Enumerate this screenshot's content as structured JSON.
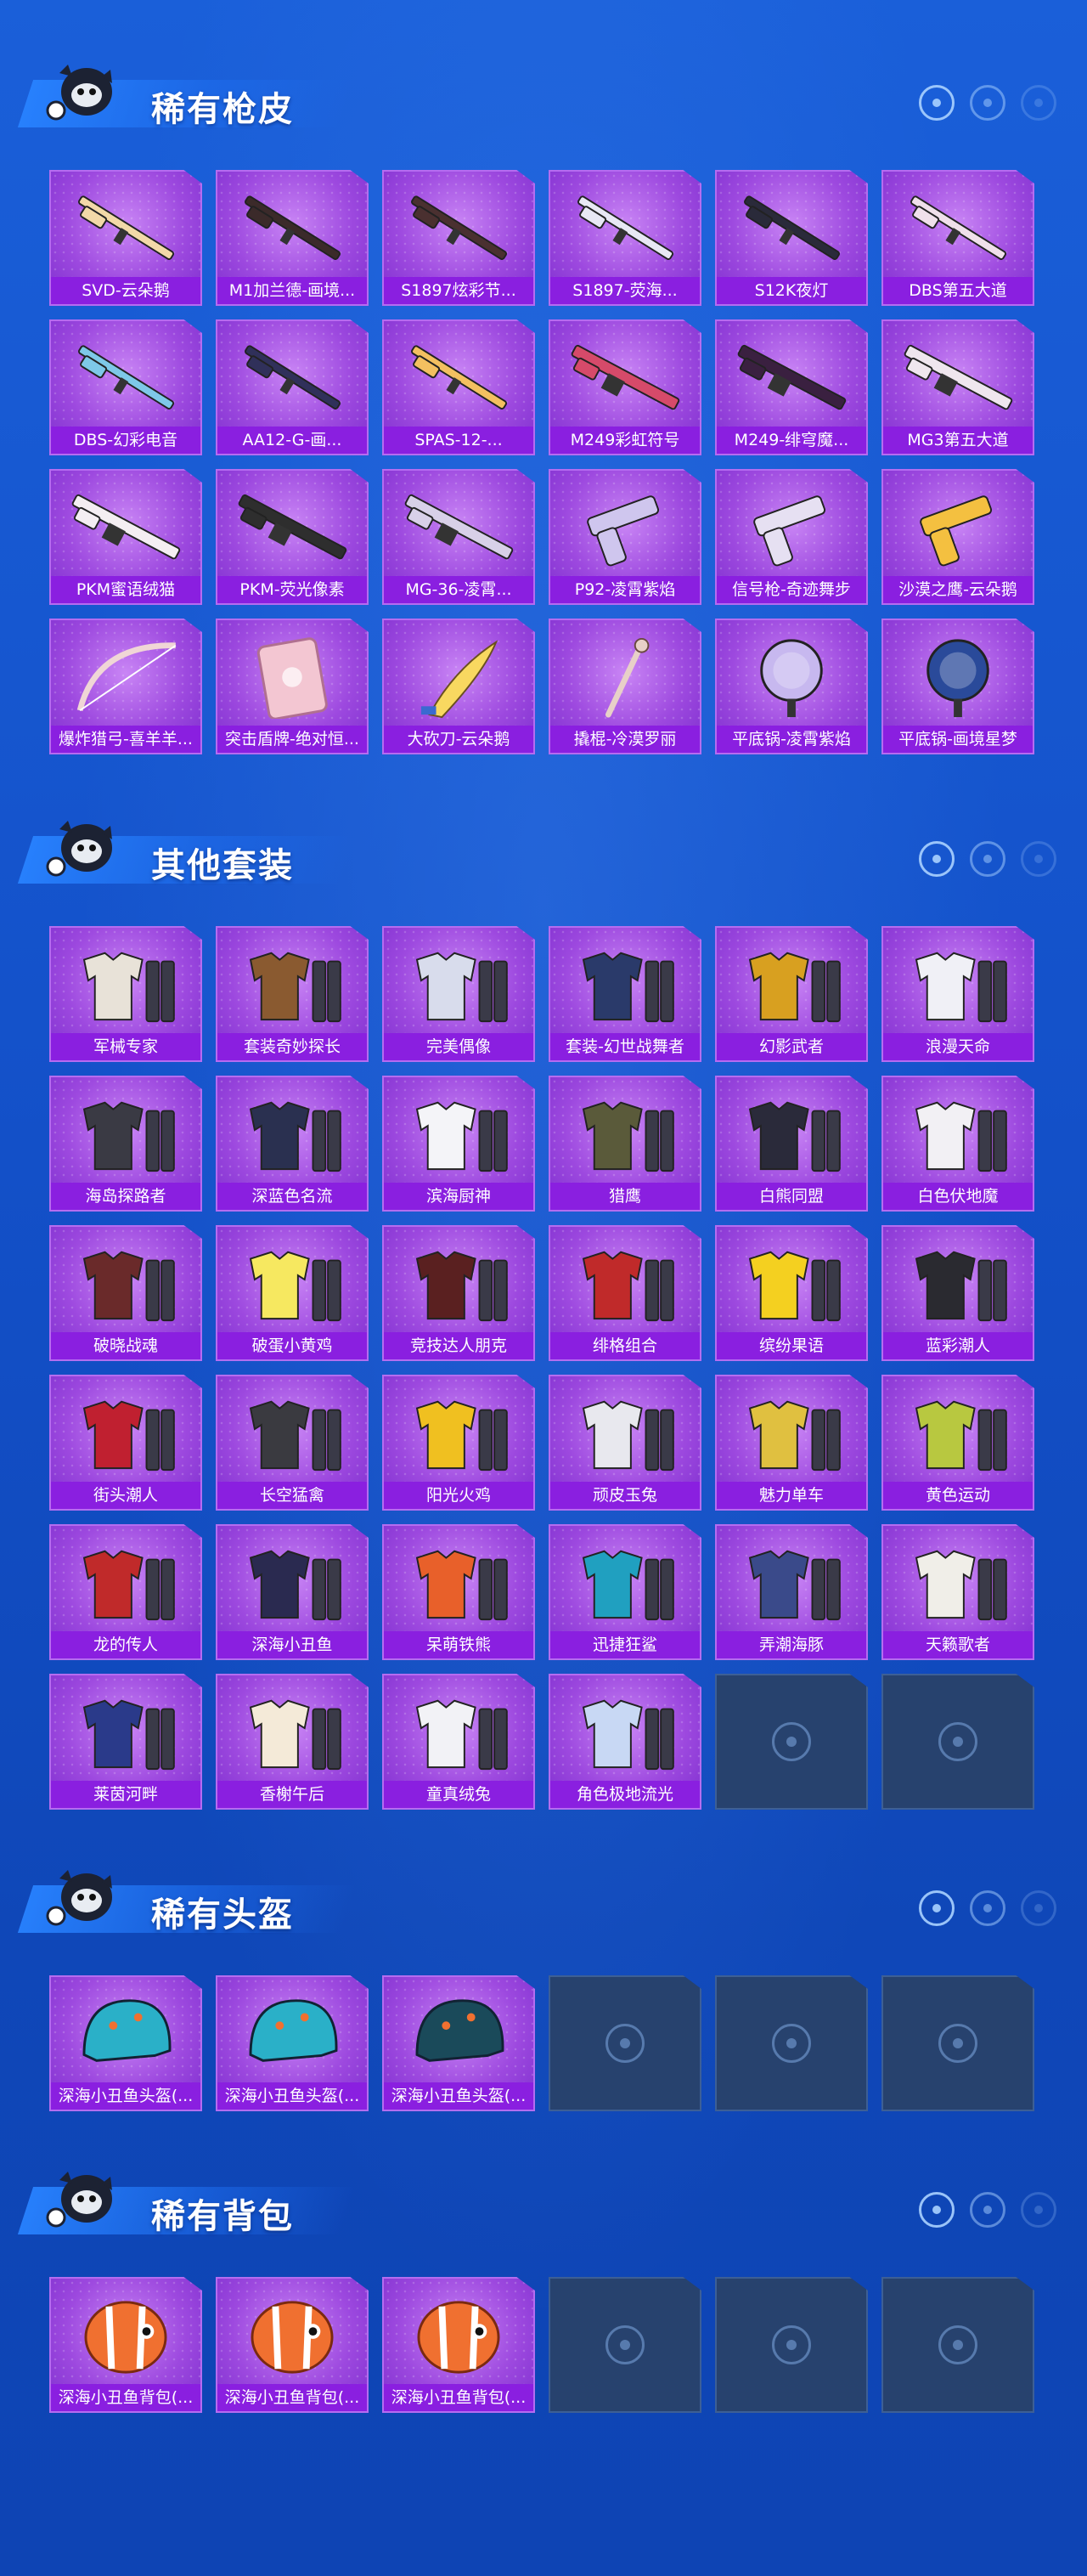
{
  "sections": [
    {
      "title": "稀有枪皮",
      "items": [
        {
          "label": "SVD-云朵鹅",
          "icon": "rifle-icon",
          "color": "#f2d9a8"
        },
        {
          "label": "M1加兰德-画境...",
          "icon": "rifle-icon",
          "color": "#3b2a2a"
        },
        {
          "label": "S1897炫彩节...",
          "icon": "shotgun-icon",
          "color": "#4a3030"
        },
        {
          "label": "S1897-荧海...",
          "icon": "shotgun-icon",
          "color": "#e8e8f4"
        },
        {
          "label": "S12K夜灯",
          "icon": "shotgun-icon",
          "color": "#2a2a3a"
        },
        {
          "label": "DBS第五大道",
          "icon": "shotgun-icon",
          "color": "#f0e0ea"
        },
        {
          "label": "DBS-幻彩电音",
          "icon": "shotgun-icon",
          "color": "#7ec8e8"
        },
        {
          "label": "AA12-G-画...",
          "icon": "shotgun-icon",
          "color": "#30305a"
        },
        {
          "label": "SPAS-12-...",
          "icon": "shotgun-icon",
          "color": "#f3c060"
        },
        {
          "label": "M249彩虹符号",
          "icon": "machinegun-icon",
          "color": "#d64a6a"
        },
        {
          "label": "M249-绯穹魔...",
          "icon": "machinegun-icon",
          "color": "#3a2040"
        },
        {
          "label": "MG3第五大道",
          "icon": "machinegun-icon",
          "color": "#efe6ee"
        },
        {
          "label": "PKM蜜语绒猫",
          "icon": "machinegun-icon",
          "color": "#f4eef2"
        },
        {
          "label": "PKM-荧光像素",
          "icon": "machinegun-icon",
          "color": "#2e2e2e"
        },
        {
          "label": "MG-36-凌霄...",
          "icon": "machinegun-icon",
          "color": "#d8d0e8"
        },
        {
          "label": "P92-凌霄紫焰",
          "icon": "pistol-icon",
          "color": "#cfc6ee"
        },
        {
          "label": "信号枪-奇迹舞步",
          "icon": "flaregun-icon",
          "color": "#e6e0f2"
        },
        {
          "label": "沙漠之鹰-云朵鹅",
          "icon": "pistol-icon",
          "color": "#f4c040"
        },
        {
          "label": "爆炸猎弓-喜羊羊...",
          "icon": "bow-icon",
          "color": "#f0d6d6"
        },
        {
          "label": "突击盾牌-绝对恒...",
          "icon": "shield-icon",
          "color": "#f3c6d2"
        },
        {
          "label": "大砍刀-云朵鹅",
          "icon": "machete-icon",
          "color": "#f8d860"
        },
        {
          "label": "撬棍-冷漠罗丽",
          "icon": "crowbar-icon",
          "color": "#e8d0c8"
        },
        {
          "label": "平底锅-凌霄紫焰",
          "icon": "pan-icon",
          "color": "#c7b8ef"
        },
        {
          "label": "平底锅-画境星梦",
          "icon": "pan-icon",
          "color": "#2a4a9a"
        }
      ]
    },
    {
      "title": "其他套装",
      "items": [
        {
          "label": "军械专家",
          "icon": "outfit-icon",
          "color": "#e8e2d8"
        },
        {
          "label": "套装奇妙探长",
          "icon": "outfit-icon",
          "color": "#8a5a30"
        },
        {
          "label": "完美偶像",
          "icon": "outfit-icon",
          "color": "#d8dcec"
        },
        {
          "label": "套装-幻世战舞者",
          "icon": "outfit-icon",
          "color": "#2a3a6a"
        },
        {
          "label": "幻影武者",
          "icon": "outfit-icon",
          "color": "#d8a020"
        },
        {
          "label": "浪漫天命",
          "icon": "outfit-icon",
          "color": "#f0f0f6"
        },
        {
          "label": "海岛探路者",
          "icon": "outfit-icon",
          "color": "#3a3a44"
        },
        {
          "label": "深蓝色名流",
          "icon": "outfit-icon",
          "color": "#2a3050"
        },
        {
          "label": "滨海厨神",
          "icon": "outfit-icon",
          "color": "#f4f4f8"
        },
        {
          "label": "猎鹰",
          "icon": "outfit-icon",
          "color": "#5a5a3a"
        },
        {
          "label": "白熊同盟",
          "icon": "outfit-icon",
          "color": "#2a2a3a"
        },
        {
          "label": "白色伏地魔",
          "icon": "outfit-icon",
          "color": "#f2f0f4"
        },
        {
          "label": "破晓战魂",
          "icon": "outfit-icon",
          "color": "#6a2a2a"
        },
        {
          "label": "破蛋小黄鸡",
          "icon": "outfit-icon",
          "color": "#f6e860"
        },
        {
          "label": "竞技达人朋克",
          "icon": "outfit-icon",
          "color": "#5a2020"
        },
        {
          "label": "绯格组合",
          "icon": "outfit-icon",
          "color": "#c02a2a"
        },
        {
          "label": "缤纷果语",
          "icon": "outfit-icon",
          "color": "#f4d020"
        },
        {
          "label": "蓝彩潮人",
          "icon": "outfit-icon",
          "color": "#2a2a30"
        },
        {
          "label": "街头潮人",
          "icon": "outfit-icon",
          "color": "#c02030"
        },
        {
          "label": "长空猛禽",
          "icon": "outfit-icon",
          "color": "#3a3a40"
        },
        {
          "label": "阳光火鸡",
          "icon": "outfit-icon",
          "color": "#f0c020"
        },
        {
          "label": "顽皮玉兔",
          "icon": "outfit-icon",
          "color": "#e8e8ee"
        },
        {
          "label": "魅力单车",
          "icon": "outfit-icon",
          "color": "#e0c040"
        },
        {
          "label": "黄色运动",
          "icon": "outfit-icon",
          "color": "#b8c840"
        },
        {
          "label": "龙的传人",
          "icon": "outfit-icon",
          "color": "#c02a2a"
        },
        {
          "label": "深海小丑鱼",
          "icon": "outfit-icon",
          "color": "#2a2a50"
        },
        {
          "label": "呆萌铁熊",
          "icon": "outfit-icon",
          "color": "#e8602a"
        },
        {
          "label": "迅捷狂鲨",
          "icon": "outfit-icon",
          "color": "#20a0c0"
        },
        {
          "label": "弄潮海豚",
          "icon": "outfit-icon",
          "color": "#3a4a8a"
        },
        {
          "label": "天籁歌者",
          "icon": "outfit-icon",
          "color": "#f0eee8"
        },
        {
          "label": "莱茵河畔",
          "icon": "outfit-icon",
          "color": "#2a3a8a"
        },
        {
          "label": "香榭午后",
          "icon": "outfit-icon",
          "color": "#f4ead8"
        },
        {
          "label": "童真绒兔",
          "icon": "outfit-icon",
          "color": "#f2f2f6"
        },
        {
          "label": "角色极地流光",
          "icon": "outfit-icon",
          "color": "#c8d8f4"
        },
        {
          "empty": true
        },
        {
          "empty": true
        }
      ]
    },
    {
      "title": "稀有头盔",
      "items": [
        {
          "label": "深海小丑鱼头盔(...",
          "icon": "helmet-icon",
          "color": "#2ab0c8"
        },
        {
          "label": "深海小丑鱼头盔(...",
          "icon": "helmet-icon",
          "color": "#2ab0c8"
        },
        {
          "label": "深海小丑鱼头盔(...",
          "icon": "helmet-icon",
          "color": "#1a4a5a"
        },
        {
          "empty": true
        },
        {
          "empty": true
        },
        {
          "empty": true
        }
      ]
    },
    {
      "title": "稀有背包",
      "items": [
        {
          "label": "深海小丑鱼背包(...",
          "icon": "backpack-icon",
          "color": "#f07030"
        },
        {
          "label": "深海小丑鱼背包(...",
          "icon": "backpack-icon",
          "color": "#f07030"
        },
        {
          "label": "深海小丑鱼背包(...",
          "icon": "backpack-icon",
          "color": "#f07030"
        },
        {
          "empty": true
        },
        {
          "empty": true
        },
        {
          "empty": true
        }
      ]
    }
  ]
}
